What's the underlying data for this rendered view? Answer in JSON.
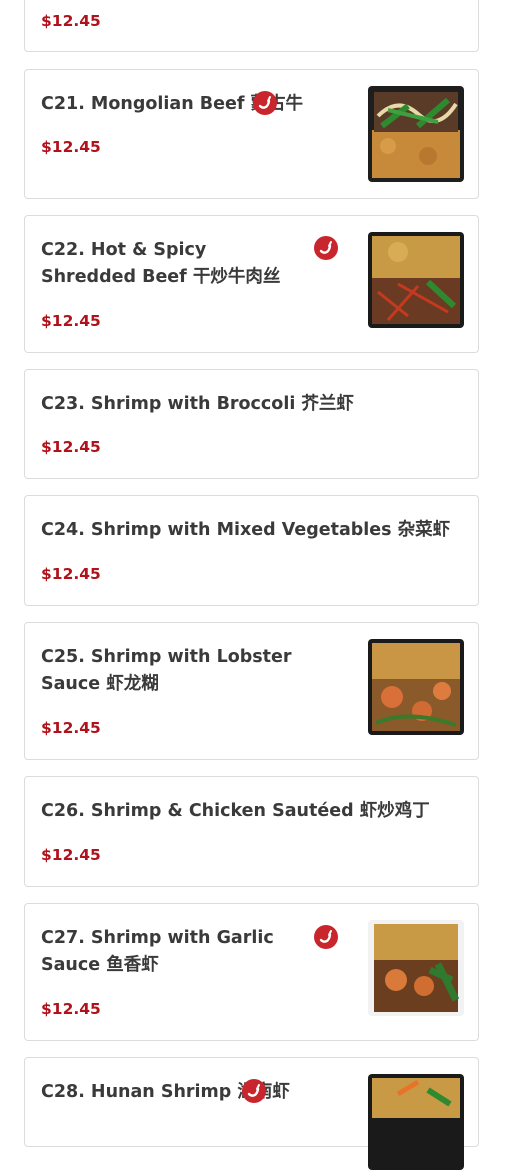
{
  "colors": {
    "price": "#b0121c",
    "name": "#3a3a3a",
    "spicy_icon": "#c9252c",
    "card_border": "#dcdcdc"
  },
  "items": [
    {
      "price": "$12.45"
    },
    {
      "name": "C21. Mongolian Beef 蒙古牛",
      "price": "$12.45",
      "spicy": true,
      "has_photo": true
    },
    {
      "name": "C22. Hot & Spicy Shredded Beef 干炒牛肉丝",
      "price": "$12.45",
      "spicy": true,
      "has_photo": true
    },
    {
      "name": "C23. Shrimp with Broccoli 芥兰虾",
      "price": "$12.45",
      "spicy": false,
      "has_photo": false
    },
    {
      "name": "C24. Shrimp with Mixed Vegetables 杂菜虾",
      "price": "$12.45",
      "spicy": false,
      "has_photo": false
    },
    {
      "name": "C25. Shrimp with Lobster Sauce 虾龙糊",
      "price": "$12.45",
      "spicy": false,
      "has_photo": true
    },
    {
      "name": "C26. Shrimp & Chicken Sautéed 虾炒鸡丁",
      "price": "$12.45",
      "spicy": false,
      "has_photo": false
    },
    {
      "name": "C27. Shrimp with Garlic Sauce 鱼香虾",
      "price": "$12.45",
      "spicy": true,
      "has_photo": true
    },
    {
      "name": "C28. Hunan Shrimp 湖南虾",
      "price": "",
      "spicy": true,
      "has_photo": true
    }
  ],
  "icons": {
    "spicy": "chili-pepper-icon"
  }
}
